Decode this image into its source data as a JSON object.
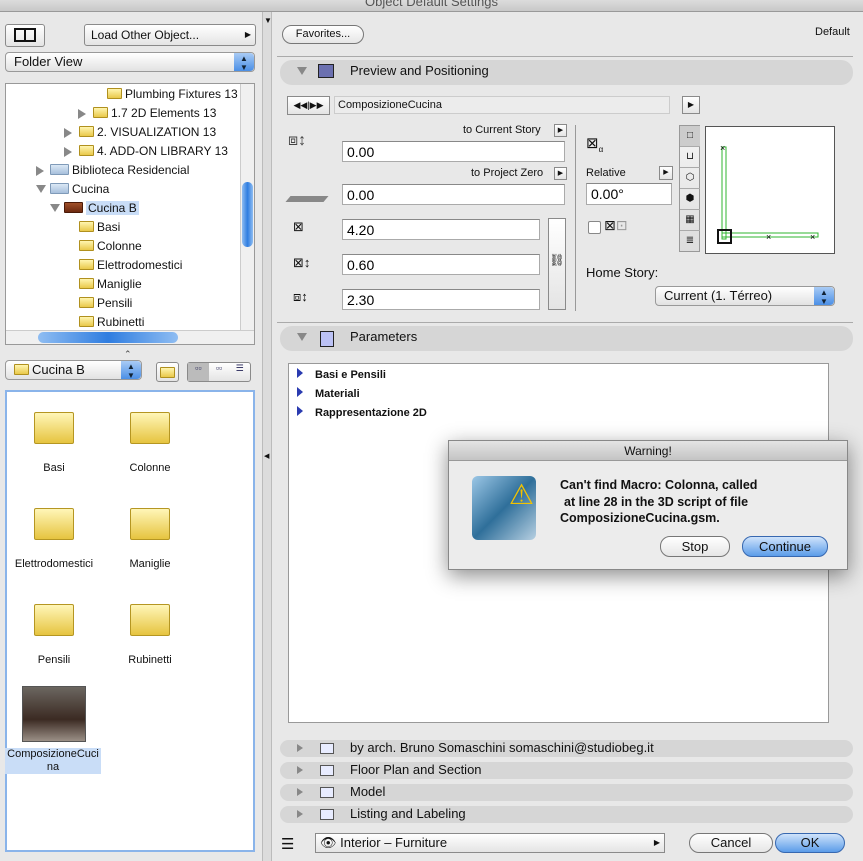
{
  "window": {
    "title": "Object Default Settings"
  },
  "left": {
    "load_other": "Load Other Object...",
    "view_mode": "Folder View",
    "tree": [
      {
        "label": "Plumbing Fixtures 13",
        "type": "folder",
        "arrow": "none"
      },
      {
        "label": "1.7 2D Elements 13",
        "type": "folder",
        "arrow": "right"
      },
      {
        "label": "2. VISUALIZATION 13",
        "type": "folder",
        "arrow": "right"
      },
      {
        "label": "4. ADD-ON LIBRARY 13",
        "type": "folder",
        "arrow": "right"
      },
      {
        "label": "Biblioteca Residencial",
        "type": "blue",
        "arrow": "right"
      },
      {
        "label": "Cucina",
        "type": "blue",
        "arrow": "down"
      },
      {
        "label": "Cucina B",
        "type": "brown",
        "arrow": "down",
        "selected": true
      },
      {
        "label": "Basi",
        "type": "folder",
        "arrow": "none"
      },
      {
        "label": "Colonne",
        "type": "folder",
        "arrow": "none"
      },
      {
        "label": "Elettrodomestici",
        "type": "folder",
        "arrow": "none"
      },
      {
        "label": "Maniglie",
        "type": "folder",
        "arrow": "none"
      },
      {
        "label": "Pensili",
        "type": "folder",
        "arrow": "none"
      },
      {
        "label": "Rubinetti",
        "type": "folder",
        "arrow": "none"
      }
    ],
    "current_folder": "Cucina B",
    "icons": [
      {
        "label": "Basi"
      },
      {
        "label": "Colonne"
      },
      {
        "label": "Elettrodomestici"
      },
      {
        "label": "Maniglie"
      },
      {
        "label": "Pensili"
      },
      {
        "label": "Rubinetti"
      },
      {
        "label": "ComposizioneCucina",
        "selected": true
      }
    ]
  },
  "right": {
    "favorites": "Favorites...",
    "default_label": "Default",
    "preview_section": "Preview and Positioning",
    "object_name": "ComposizioneCucina",
    "to_current_story": "to Current Story",
    "to_project_zero": "to Project Zero",
    "elevation_story": "0.00",
    "elevation_zero": "0.00",
    "width": "4.20",
    "depth": "0.60",
    "height": "2.30",
    "relative": "Relative",
    "angle": "0.00°",
    "home_story_label": "Home Story:",
    "home_story": "Current (1. Térreo)",
    "parameters_section": "Parameters",
    "parameters": [
      "Basi e Pensili",
      "Materiali",
      "Rappresentazione 2D"
    ],
    "sections": [
      "by arch. Bruno Somaschini somaschini@studiobeg.it",
      "Floor Plan and Section",
      "Model",
      "Listing and Labeling"
    ],
    "layer": "Interior – Furniture",
    "cancel": "Cancel",
    "ok": "OK"
  },
  "dialog": {
    "title": "Warning!",
    "message": [
      "Can't find Macro: Colonna, called",
      "at line 28 in the 3D script of file",
      "ComposizioneCucina.gsm."
    ],
    "stop": "Stop",
    "continue": "Continue"
  },
  "colors": {
    "accent": "#3d86e5",
    "selection": "#c9ddf7",
    "green": "#2fb52f"
  }
}
